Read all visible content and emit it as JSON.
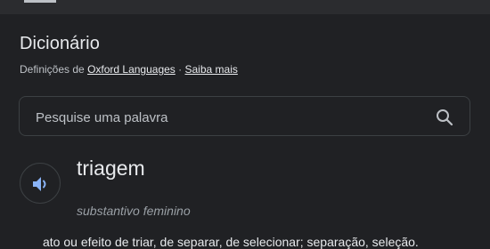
{
  "header": {
    "title": "Dicionário",
    "source_prefix": "Definições de",
    "source_link": "Oxford Languages",
    "separator": "·",
    "learn_more": "Saiba mais"
  },
  "search": {
    "placeholder": "Pesquise uma palavra",
    "value": "",
    "icon": "search-icon"
  },
  "entry": {
    "word": "triagem",
    "part_of_speech": "substantivo feminino",
    "definition": "ato ou efeito de triar, de separar, de selecionar; separação, seleção.",
    "audio_icon": "speaker-icon"
  },
  "colors": {
    "background": "#202124",
    "accent": "#8ab4f8",
    "border": "#3c4043"
  }
}
